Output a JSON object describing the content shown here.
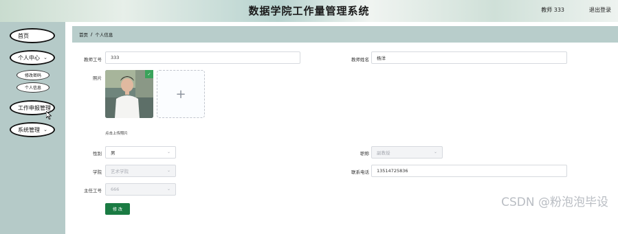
{
  "header": {
    "title": "数据学院工作量管理系统",
    "user": "教师 333",
    "logout": "退出登录"
  },
  "sidebar": {
    "items": [
      {
        "label": "首页"
      },
      {
        "label": "个人中心",
        "chevron": "chevron-down-icon"
      },
      {
        "label": "工作申报管理"
      },
      {
        "label": "系统管理",
        "chevron": "chevron-down-icon"
      }
    ],
    "sub_items": [
      {
        "label": "修改密码"
      },
      {
        "label": "个人信息"
      }
    ]
  },
  "breadcrumb": {
    "home": "首页",
    "separator": "/",
    "current": "个人信息"
  },
  "form": {
    "teacher_id": {
      "label": "教师工号",
      "value": "333"
    },
    "teacher_name": {
      "label": "教师姓名",
      "value": "杨洋"
    },
    "photo": {
      "label": "照片",
      "upload_tip": "点击上传照片",
      "plus": "+"
    },
    "gender": {
      "label": "性别",
      "value": "男"
    },
    "title": {
      "label": "职称",
      "value": "副教授"
    },
    "college": {
      "label": "学院",
      "value": "艺术学院"
    },
    "phone": {
      "label": "联系电话",
      "value": "13514725836"
    },
    "director_id": {
      "label": "主任工号",
      "value": "666"
    },
    "submit_label": "修 改"
  },
  "colors": {
    "sidebar_bg": "#b5cac8",
    "breadcrumb_bg": "#b8cdcb",
    "primary_button": "#1a7b43",
    "check_badge": "#3aa35b"
  },
  "watermark": "CSDN @粉泡泡毕设"
}
